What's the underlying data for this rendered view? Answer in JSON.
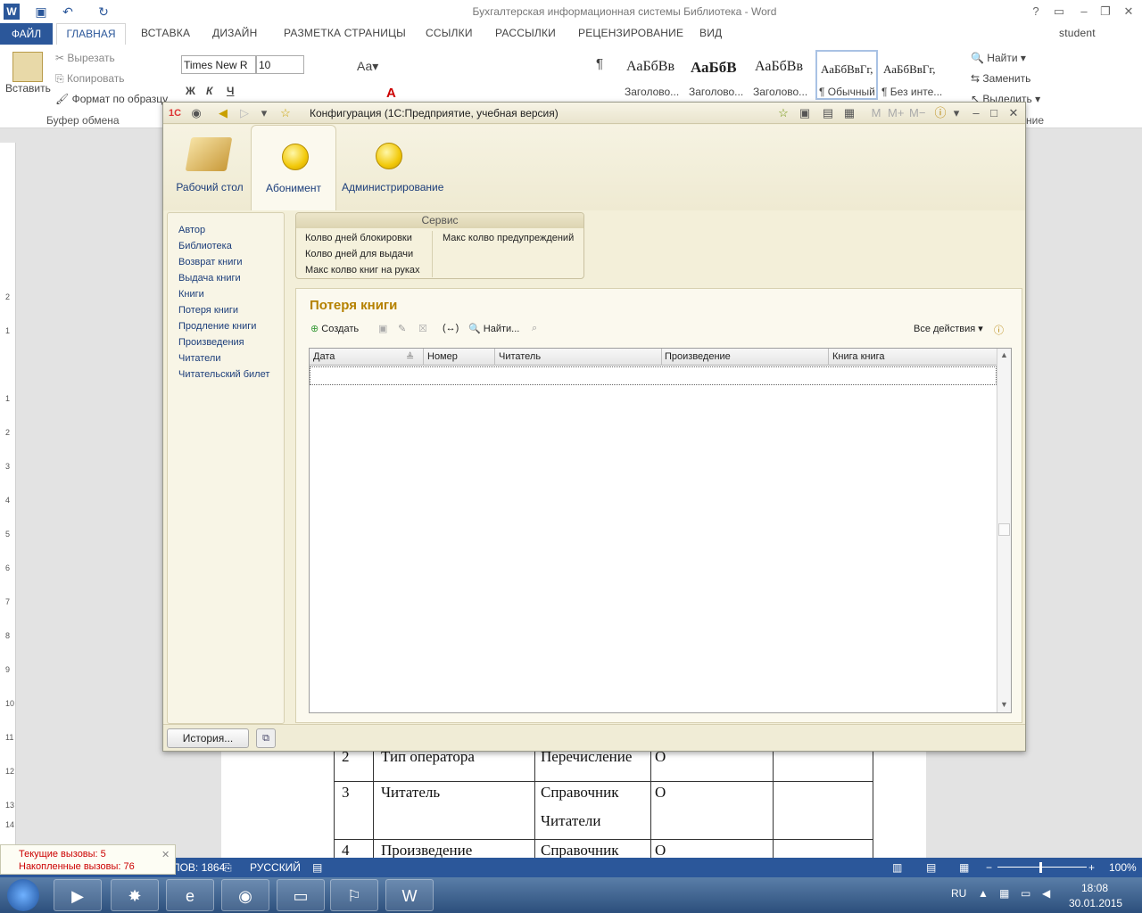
{
  "word": {
    "title": "Бухгалтерская информационная системы Библиотека - Word",
    "user": "student",
    "tabs": [
      "ФАЙЛ",
      "ГЛАВНАЯ",
      "ВСТАВКА",
      "ДИЗАЙН",
      "РАЗМЕТКА СТРАНИЦЫ",
      "ССЫЛКИ",
      "РАССЫЛКИ",
      "РЕЦЕНЗИРОВАНИЕ",
      "ВИД"
    ],
    "clipboard": {
      "paste": "Вставить",
      "cut": "Вырезать",
      "copy": "Копировать",
      "format": "Формат по образцу",
      "group": "Буфер обмена"
    },
    "font": {
      "name": "Times New R",
      "size": "10"
    },
    "styles": [
      {
        "sample": "АаБбВв",
        "name": "Заголово..."
      },
      {
        "sample": "АаБбВ",
        "name": "Заголово..."
      },
      {
        "sample": "АаБбВв",
        "name": "Заголово..."
      },
      {
        "sample": "АаБбВвГг,",
        "name": "¶ Обычный"
      },
      {
        "sample": "АаБбВвГг,",
        "name": "¶ Без инте..."
      }
    ],
    "editing": {
      "find": "Найти",
      "replace": "Заменить",
      "select": "Выделить",
      "group": "ние"
    },
    "doc_rows": [
      {
        "n": "2",
        "field": "Тип оператора",
        "type": "Перечисление",
        "o": "О"
      },
      {
        "n": "3",
        "field": "Читатель",
        "type": "Справочник",
        "type2": "Читатели",
        "o": "О"
      },
      {
        "n": "4",
        "field": "Произведение",
        "type": "Справочник",
        "o": "О"
      }
    ],
    "status": {
      "words": "ЧИСЛО СЛОВ: 1864",
      "lang": "РУССКИЙ",
      "zoom": "100%"
    },
    "ruler": [
      "2",
      "1",
      "1",
      "2",
      "3",
      "4",
      "5",
      "6",
      "7",
      "8",
      "9",
      "10",
      "11",
      "12",
      "13",
      "14"
    ]
  },
  "calls": {
    "current": "Текущие вызовы: 5",
    "accum": "Накопленные вызовы: 76"
  },
  "taskbar": {
    "lang": "RU",
    "time": "18:08",
    "date": "30.01.2015"
  },
  "c1": {
    "title": "Конфигурация  (1С:Предприятие, учебная версия)",
    "sections": [
      {
        "label": "Рабочий стол"
      },
      {
        "label": "Абонимент"
      },
      {
        "label": "Администрирование"
      }
    ],
    "nav": [
      "Автор",
      "Библиотека",
      "Возврат книги",
      "Выдача книги",
      "Книги",
      "Потеря книги",
      "Продление книги",
      "Произведения",
      "Читатели",
      "Читательский билет"
    ],
    "service": {
      "title": "Сервис",
      "items": [
        "Колво дней блокировки",
        "Колво дней для выдачи",
        "Макс колво книг на руках",
        "Макс колво предупреждений"
      ]
    },
    "form": {
      "title": "Потеря книги",
      "create": "Создать",
      "find": "Найти...",
      "all_actions": "Все действия",
      "columns": [
        "Дата",
        "Номер",
        "Читатель",
        "Произведение",
        "Книга книга"
      ]
    },
    "history": "История..."
  }
}
